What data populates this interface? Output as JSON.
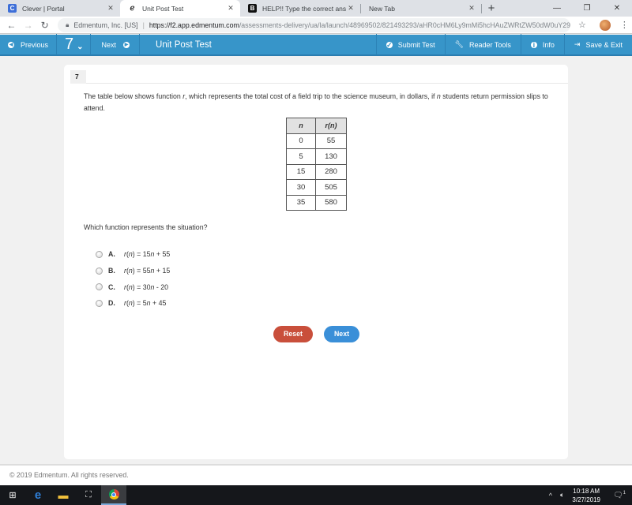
{
  "browser": {
    "tabs": [
      {
        "title": "Clever | Portal",
        "favicon": "clever-icon",
        "active": false
      },
      {
        "title": "Unit Post Test",
        "favicon": "edmentum-icon",
        "active": true
      },
      {
        "title": "HELP!! Type the correct answer in",
        "favicon": "brainly-icon",
        "active": false
      },
      {
        "title": "New Tab",
        "favicon": "",
        "active": false
      }
    ],
    "new_tab_glyph": "+",
    "window_controls": {
      "minimize": "—",
      "restore": "❐",
      "close": "✕"
    },
    "address": {
      "site_label": "Edmentum, Inc. [US]",
      "url_host": "https://f2.app.edmentum.com",
      "url_path": "/assessments-delivery/ua/la/launch/48969502/821493293/aHR0cHM6Ly9mMi5hcHAuZWRtZW50dW0uY29tL2x..."
    }
  },
  "appbar": {
    "previous_label": "Previous",
    "question_number": "7",
    "next_label": "Next",
    "title": "Unit Post Test",
    "submit_label": "Submit Test",
    "reader_tools_label": "Reader Tools",
    "info_label": "Info",
    "save_exit_label": "Save & Exit"
  },
  "question": {
    "number": "7",
    "prompt_parts": [
      "The table below shows function ",
      "r",
      ", which represents the total cost of a field trip to the science museum, in dollars, if ",
      "n",
      " students return permission slips to attend."
    ],
    "table": {
      "headers": [
        "n",
        "r(n)"
      ],
      "rows": [
        [
          "0",
          "55"
        ],
        [
          "5",
          "130"
        ],
        [
          "15",
          "280"
        ],
        [
          "30",
          "505"
        ],
        [
          "35",
          "580"
        ]
      ]
    },
    "ask": "Which function represents the situation?",
    "choices": [
      {
        "letter": "A.",
        "text": "r(n) = 15n + 55",
        "selected": false
      },
      {
        "letter": "B.",
        "text": "r(n) = 55n + 15",
        "selected": false
      },
      {
        "letter": "C.",
        "text": "r(n) = 30n - 20",
        "selected": false
      },
      {
        "letter": "D.",
        "text": "r(n) = 5n + 45",
        "selected": false
      }
    ],
    "reset_label": "Reset",
    "next_label": "Next"
  },
  "footer": {
    "copyright": "© 2019 Edmentum. All rights reserved."
  },
  "taskbar": {
    "time": "10:18 AM",
    "date": "3/27/2019",
    "notification_count": "1"
  },
  "colors": {
    "appbar_blue": "#3795c9",
    "reset_red": "#c94f3b",
    "next_blue": "#3a8fd8"
  }
}
